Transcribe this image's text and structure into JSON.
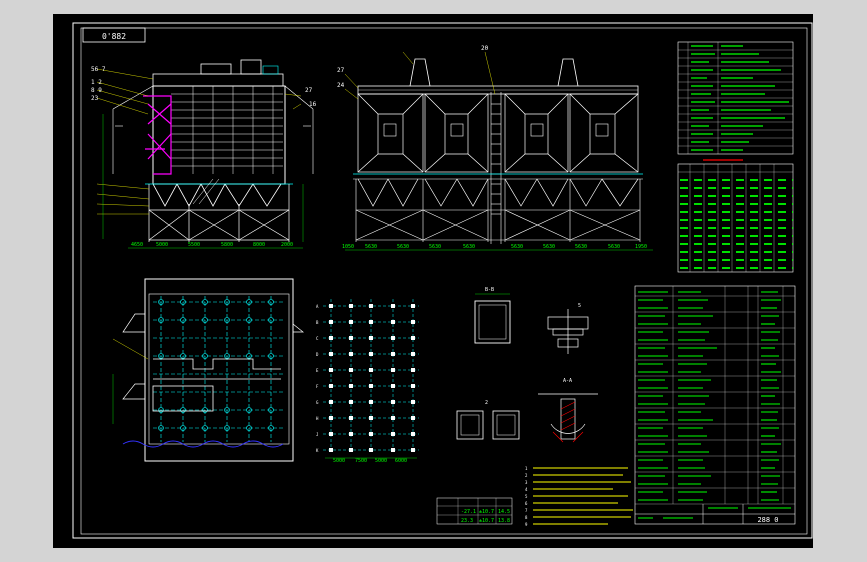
{
  "title_block": {
    "drawing_no_top": "0'882",
    "drawing_no_bottom": "288 0"
  },
  "front_view": {
    "part_numbers_left": [
      "56 7",
      "1 2",
      "8 9",
      "23"
    ],
    "part_numbers_right": [
      "27",
      "16"
    ],
    "bottom_dims": [
      "4650",
      "5000",
      "5500",
      "5800",
      "8000",
      "2000"
    ]
  },
  "side_view": {
    "callouts": [
      "27",
      "20",
      "24"
    ],
    "bottom_dims": [
      "1050",
      "5630",
      "5630",
      "5630",
      "5630",
      "5630",
      "5630",
      "5630",
      "5630",
      "1950"
    ]
  },
  "grid_view": {
    "row_labels": [
      "A",
      "B",
      "C",
      "D",
      "E",
      "F",
      "G",
      "H",
      "J",
      "K"
    ],
    "bottom_dims": [
      "5000",
      "7500",
      "5000",
      "6000"
    ]
  },
  "detail_view": {
    "label_a": "B-B",
    "label_b": "2",
    "label_c": "5",
    "label_d": "A-A"
  },
  "note_lines": [
    "1",
    "2",
    "3",
    "4",
    "5",
    "6",
    "7",
    "8",
    "9"
  ],
  "small_table": {
    "row1": [
      "-27.1",
      "±10.7",
      "14.5"
    ],
    "row2": [
      "23.3",
      "±10.7",
      "13.8"
    ]
  },
  "colors": {
    "background": "#000000",
    "frame": "#ffffff",
    "outline": "#ffffff",
    "text": "#00ff00",
    "hidden": "#00ffff",
    "cut": "#ff00ff",
    "hatch": "#ff0000",
    "water": "#3333ff",
    "yellow": "#ffff00"
  }
}
